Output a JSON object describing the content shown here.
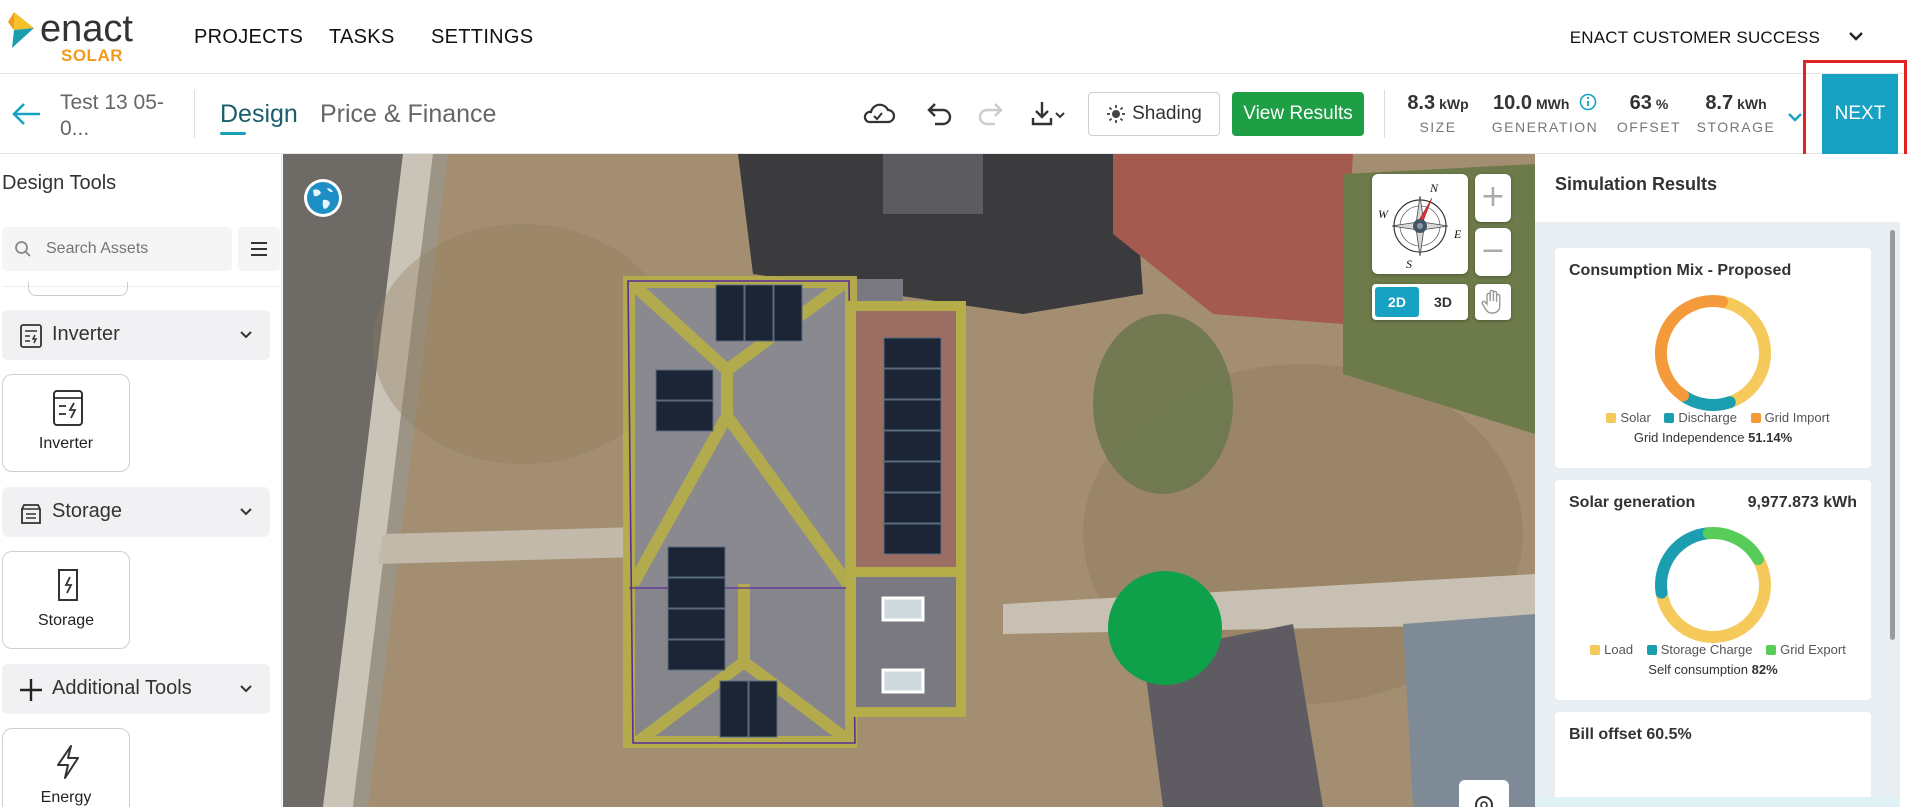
{
  "brand": {
    "name": "enact",
    "sub": "SOLAR",
    "colors": {
      "accent": "#17a2c4",
      "orange": "#f39a1c",
      "green": "#1e9e45"
    }
  },
  "nav": {
    "items": [
      "PROJECTS",
      "TASKS",
      "SETTINGS"
    ],
    "account": "ENACT CUSTOMER SUCCESS"
  },
  "toolbar": {
    "project_title": "Test 13 05-0...",
    "tabs": {
      "design": "Design",
      "price": "Price & Finance"
    },
    "shading_label": "Shading",
    "view_results_label": "View Results",
    "next_label": "NEXT",
    "stats": [
      {
        "value": "8.3",
        "unit": "kWp",
        "label": "SIZE"
      },
      {
        "value": "10.0",
        "unit": "MWh",
        "label": "GENERATION"
      },
      {
        "value": "63",
        "unit": "%",
        "label": "OFFSET"
      },
      {
        "value": "8.7",
        "unit": "kWh",
        "label": "STORAGE"
      }
    ]
  },
  "sidebar": {
    "title": "Design Tools",
    "search_placeholder": "Search Assets",
    "sections": [
      {
        "label": "Inverter",
        "card": "Inverter"
      },
      {
        "label": "Storage",
        "card": "Storage"
      },
      {
        "label": "Additional Tools",
        "card": "Energy"
      }
    ]
  },
  "map": {
    "compass": {
      "n": "N",
      "e": "E",
      "s": "S",
      "w": "W"
    },
    "zoom_in": "+",
    "zoom_out": "−",
    "view_2d": "2D",
    "view_3d": "3D"
  },
  "results": {
    "title": "Simulation Results",
    "consumption": {
      "title": "Consumption Mix - Proposed",
      "legend": [
        "Solar",
        "Discharge",
        "Grid Import"
      ],
      "colors": [
        "#f5c95a",
        "#1a9eb0",
        "#f59a3a"
      ],
      "values": [
        42,
        15,
        43
      ],
      "footer_label": "Grid Independence",
      "footer_value": "51.14%"
    },
    "generation": {
      "title": "Solar generation",
      "value": "9,977.873 kWh",
      "legend": [
        "Load",
        "Storage Charge",
        "Grid Export"
      ],
      "colors": [
        "#f5c95a",
        "#1a9eb0",
        "#58cc58"
      ],
      "values": [
        56,
        26,
        18
      ],
      "footer_label": "Self consumption",
      "footer_value": "82%"
    },
    "bill": {
      "title": "Bill offset 60.5%"
    }
  }
}
